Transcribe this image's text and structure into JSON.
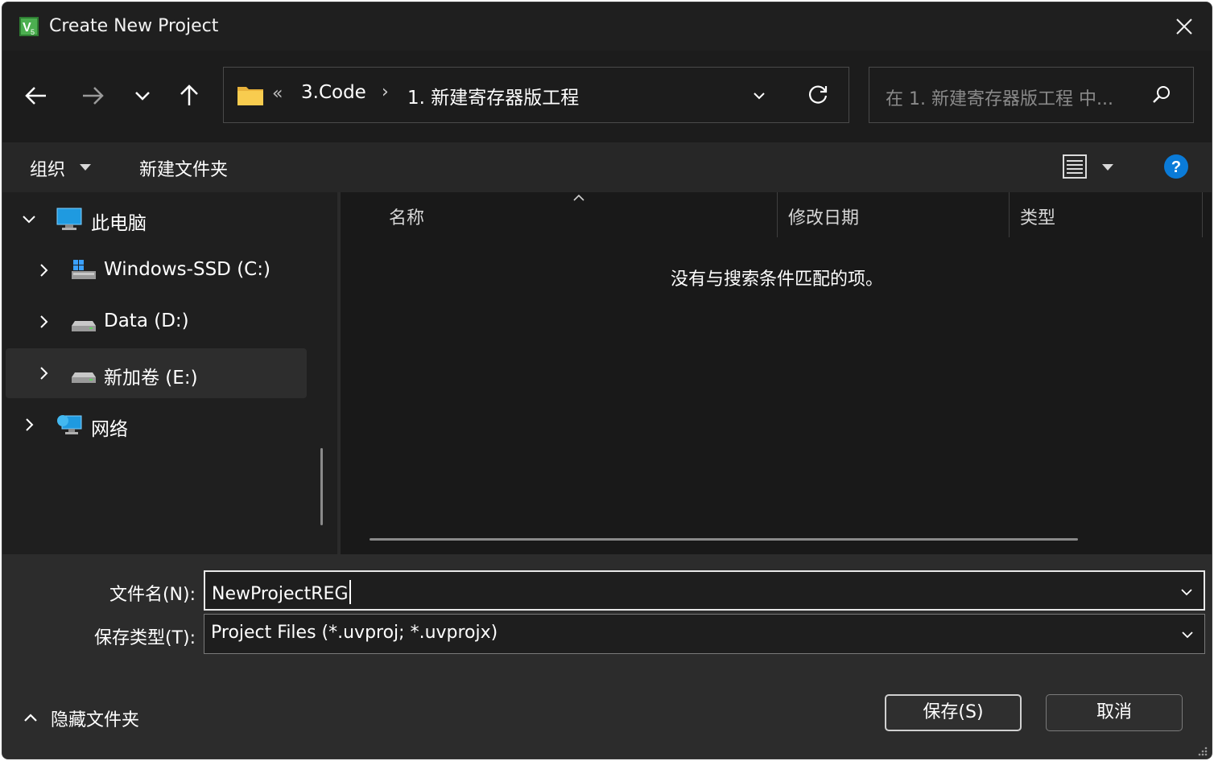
{
  "window": {
    "title": "Create New Project",
    "app_icon": "keil-uvision-icon",
    "close_icon": "close-icon"
  },
  "nav": {
    "back_icon": "arrow-left-icon",
    "forward_icon": "arrow-right-icon",
    "recent_icon": "chevron-down-icon",
    "up_icon": "arrow-up-icon",
    "address": {
      "overflow": "«",
      "crumbs": [
        "3.Code",
        "1. 新建寄存器版工程"
      ],
      "separator": "›"
    },
    "search_placeholder": "在 1. 新建寄存器版工程 中..."
  },
  "toolbar": {
    "organize": "组织",
    "new_folder": "新建文件夹"
  },
  "sidebar": {
    "items": [
      {
        "label": "此电脑",
        "icon": "computer-icon",
        "expanded": true
      },
      {
        "label": "Windows-SSD (C:)",
        "icon": "windows-drive-icon"
      },
      {
        "label": "Data (D:)",
        "icon": "drive-icon"
      },
      {
        "label": "新加卷 (E:)",
        "icon": "drive-icon",
        "selected": true
      },
      {
        "label": "网络",
        "icon": "network-icon"
      }
    ]
  },
  "filelist": {
    "columns": [
      "名称",
      "修改日期",
      "类型"
    ],
    "empty_message": "没有与搜索条件匹配的项。"
  },
  "form": {
    "filename_label": "文件名(N):",
    "filename_value": "NewProjectREG",
    "filetype_label": "保存类型(T):",
    "filetype_value": "Project Files (*.uvproj; *.uvprojx)"
  },
  "footer": {
    "hide_folders": "隐藏文件夹",
    "save_button": "保存(S)",
    "cancel_button": "取消"
  },
  "colors": {
    "window_bg": "#202020",
    "accent_help": "#0a7bd8",
    "folder": "#f4c542"
  }
}
